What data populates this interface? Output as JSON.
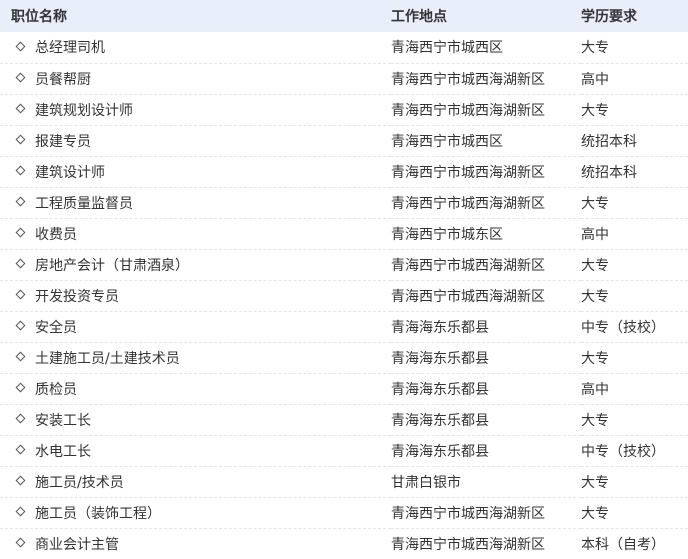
{
  "table": {
    "headers": {
      "name": "职位名称",
      "location": "工作地点",
      "education": "学历要求"
    },
    "rows": [
      {
        "name": "总经理司机",
        "location": "青海西宁市城西区",
        "education": "大专"
      },
      {
        "name": "员餐帮厨",
        "location": "青海西宁市城西海湖新区",
        "education": "高中"
      },
      {
        "name": "建筑规划设计师",
        "location": "青海西宁市城西海湖新区",
        "education": "大专"
      },
      {
        "name": "报建专员",
        "location": "青海西宁市城西区",
        "education": "统招本科"
      },
      {
        "name": "建筑设计师",
        "location": "青海西宁市城西海湖新区",
        "education": "统招本科"
      },
      {
        "name": "工程质量监督员",
        "location": "青海西宁市城西海湖新区",
        "education": "大专"
      },
      {
        "name": "收费员",
        "location": "青海西宁市城东区",
        "education": "高中"
      },
      {
        "name": "房地产会计（甘肃酒泉）",
        "location": "青海西宁市城西海湖新区",
        "education": "大专"
      },
      {
        "name": "开发投资专员",
        "location": "青海西宁市城西海湖新区",
        "education": "大专"
      },
      {
        "name": "安全员",
        "location": "青海海东乐都县",
        "education": "中专（技校）"
      },
      {
        "name": "土建施工员/土建技术员",
        "location": "青海海东乐都县",
        "education": "大专"
      },
      {
        "name": "质检员",
        "location": "青海海东乐都县",
        "education": "高中"
      },
      {
        "name": "安装工长",
        "location": "青海海东乐都县",
        "education": "大专"
      },
      {
        "name": "水电工长",
        "location": "青海海东乐都县",
        "education": "中专（技校）"
      },
      {
        "name": "施工员/技术员",
        "location": "甘肃白银市",
        "education": "大专"
      },
      {
        "name": "施工员（装饰工程）",
        "location": "青海西宁市城西海湖新区",
        "education": "大专"
      },
      {
        "name": "商业会计主管",
        "location": "青海西宁市城西海湖新区",
        "education": "本科（自考）"
      }
    ]
  },
  "colors": {
    "header_bg": "#e9eefb",
    "text": "#333333",
    "row_divider": "#e6e6e6"
  },
  "icons": {
    "row_bullet": "diamond-bullet-icon"
  }
}
